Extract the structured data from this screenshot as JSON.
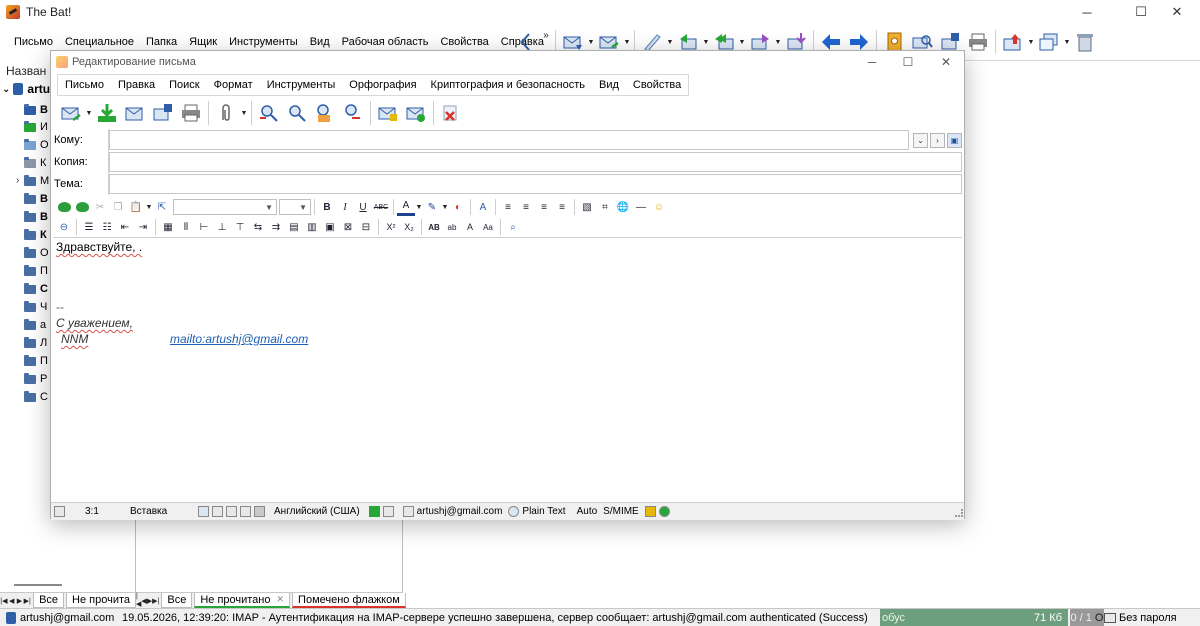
{
  "main": {
    "title": "The Bat!",
    "menu": [
      "Письмо",
      "Специальное",
      "Папка",
      "Ящик",
      "Инструменты",
      "Вид",
      "Рабочая область",
      "Свойства",
      "Справка"
    ],
    "overflow": "»"
  },
  "folders": {
    "header": "Назван",
    "account": "artu",
    "rows": [
      {
        "label": "В",
        "bold": true
      },
      {
        "label": "И",
        "bold": false
      },
      {
        "label": "О",
        "bold": false
      },
      {
        "label": "К",
        "bold": false
      },
      {
        "label": "М",
        "bold": false
      },
      {
        "label": "В",
        "bold": true
      },
      {
        "label": "В",
        "bold": true
      },
      {
        "label": "К",
        "bold": true
      },
      {
        "label": "О",
        "bold": false
      },
      {
        "label": "П",
        "bold": false
      },
      {
        "label": "С",
        "bold": true
      },
      {
        "label": "Ч",
        "bold": false
      },
      {
        "label": "а",
        "bold": false
      },
      {
        "label": "Л",
        "bold": false
      },
      {
        "label": "П",
        "bold": false
      },
      {
        "label": "Р",
        "bold": false
      },
      {
        "label": "С",
        "bold": false
      }
    ]
  },
  "tabs_left": {
    "all": "Все",
    "unread": "Не прочита"
  },
  "tabs_list": {
    "all": "Все",
    "unread": "Не прочитано",
    "flagged": "Помечено флажком"
  },
  "status": {
    "account": "artushj@gmail.com",
    "log": "19.05.2026, 12:39:20: IMAP  - Аутентификация на IMAP-сервере успешно завершена, сервер сообщает: artushj@gmail.com authenticated (Success)",
    "green_label": "обус",
    "size": "71 Кб",
    "counter": "0 / 1",
    "counter_tail": "О",
    "password": "Без пароля"
  },
  "compose": {
    "title": "Редактирование письма",
    "menu": [
      "Письмо",
      "Правка",
      "Поиск",
      "Формат",
      "Инструменты",
      "Орфография",
      "Криптография и безопасность",
      "Вид",
      "Свойства"
    ],
    "to_label": "Кому:",
    "cc_label": "Копия:",
    "subject_label": "Тема:",
    "to_value": "",
    "cc_value": "",
    "subject_value": "",
    "body": {
      "greeting": "Здравствуйте, .",
      "sig_sep": "--",
      "sig_regards": "С уважением,",
      "sig_name": "NNM",
      "sig_email": "mailto:artushj@gmail.com"
    },
    "status": {
      "position": "3:1",
      "mode": "Вставка",
      "language": "Английский (США)",
      "account": "artushj@gmail.com",
      "format": "Plain Text",
      "auto": "Auto",
      "smime": "S/MIME"
    }
  },
  "colors": {
    "accent_blue": "#2f5ea8",
    "green_status": "#6d9f7e",
    "link": "#1f5fb5"
  }
}
